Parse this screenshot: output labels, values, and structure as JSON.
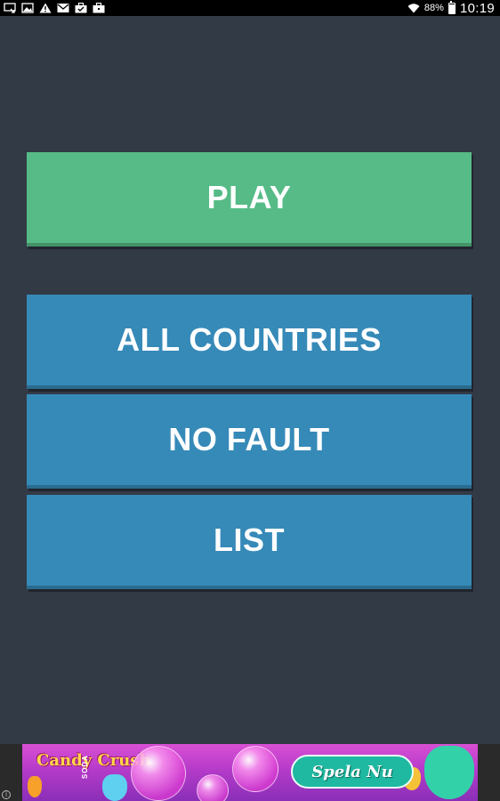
{
  "status_bar": {
    "battery_percent": "88%",
    "battery_level": 0.88,
    "clock": "10:19",
    "icons": [
      "cast-icon",
      "image-icon",
      "warning-icon",
      "mail-icon",
      "briefcase-check-icon",
      "briefcase-icon",
      "wifi-icon",
      "battery-icon"
    ]
  },
  "menu": {
    "play_label": "PLAY",
    "all_countries_label": "ALL COUNTRIES",
    "no_fault_label": "NO FAULT",
    "list_label": "LIST"
  },
  "colors": {
    "background": "#323a46",
    "play": "#56bb86",
    "mode_buttons": "#368ab8"
  },
  "ad": {
    "logo_text": "Candy Crush",
    "logo_sub": "SODA",
    "cta_label": "Spela Nu",
    "info_icon": "i"
  }
}
